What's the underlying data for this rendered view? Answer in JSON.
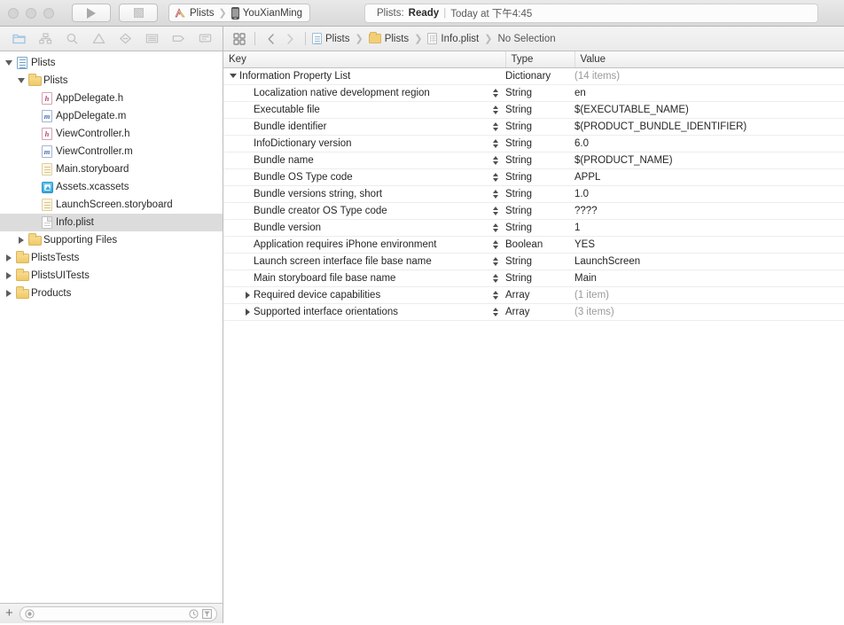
{
  "window": {
    "traffic_lights": [
      "close",
      "minimize",
      "zoom"
    ]
  },
  "toolbar": {
    "run_label": "Run",
    "stop_label": "Stop",
    "scheme": {
      "project": "Plists",
      "destination": "YouXianMing"
    }
  },
  "status": {
    "scheme": "Plists:",
    "state": "Ready",
    "divider": "|",
    "time": "Today at 下午4:45"
  },
  "navigator_tabs": [
    {
      "name": "project-navigator",
      "icon": "folder-icon"
    },
    {
      "name": "symbol-navigator",
      "icon": "hierarchy-icon"
    },
    {
      "name": "find-navigator",
      "icon": "search-icon"
    },
    {
      "name": "issue-navigator",
      "icon": "warning-triangle-icon"
    },
    {
      "name": "test-navigator",
      "icon": "breakpoint-diamond-icon"
    },
    {
      "name": "debug-navigator",
      "icon": "list-lines-icon"
    },
    {
      "name": "breakpoint-navigator",
      "icon": "tag-icon"
    },
    {
      "name": "report-navigator",
      "icon": "message-icon"
    }
  ],
  "jumpbar": {
    "back_label": "Back",
    "forward_label": "Forward",
    "related_label": "Related Items",
    "crumbs": [
      {
        "label": "Plists",
        "icon": "project-icon"
      },
      {
        "label": "Plists",
        "icon": "folder-icon"
      },
      {
        "label": "Info.plist",
        "icon": "plist-icon"
      },
      {
        "label": "No Selection",
        "icon": "none"
      }
    ]
  },
  "sidebar": {
    "items": [
      {
        "label": "Plists",
        "icon": "project-icon",
        "indent": 0,
        "twisty": "down",
        "selected": false
      },
      {
        "label": "Plists",
        "icon": "folder-icon",
        "indent": 1,
        "twisty": "down",
        "selected": false
      },
      {
        "label": "AppDelegate.h",
        "icon": "header-file-icon",
        "indent": 2,
        "twisty": "none",
        "selected": false
      },
      {
        "label": "AppDelegate.m",
        "icon": "source-file-icon",
        "indent": 2,
        "twisty": "none",
        "selected": false
      },
      {
        "label": "ViewController.h",
        "icon": "header-file-icon",
        "indent": 2,
        "twisty": "none",
        "selected": false
      },
      {
        "label": "ViewController.m",
        "icon": "source-file-icon",
        "indent": 2,
        "twisty": "none",
        "selected": false
      },
      {
        "label": "Main.storyboard",
        "icon": "storyboard-icon",
        "indent": 2,
        "twisty": "none",
        "selected": false
      },
      {
        "label": "Assets.xcassets",
        "icon": "asset-catalog-icon",
        "indent": 2,
        "twisty": "none",
        "selected": false
      },
      {
        "label": "LaunchScreen.storyboard",
        "icon": "storyboard-icon",
        "indent": 2,
        "twisty": "none",
        "selected": false
      },
      {
        "label": "Info.plist",
        "icon": "plist-icon",
        "indent": 2,
        "twisty": "none",
        "selected": true
      },
      {
        "label": "Supporting Files",
        "icon": "folder-icon",
        "indent": 1,
        "twisty": "right",
        "selected": false
      },
      {
        "label": "PlistsTests",
        "icon": "folder-icon",
        "indent": 0,
        "twisty": "right",
        "selected": false
      },
      {
        "label": "PlistsUITests",
        "icon": "folder-icon",
        "indent": 0,
        "twisty": "right",
        "selected": false
      },
      {
        "label": "Products",
        "icon": "folder-icon",
        "indent": 0,
        "twisty": "right",
        "selected": false
      }
    ],
    "footer": {
      "add_label": "+",
      "filter_placeholder": "",
      "recent_icon": "clock-icon",
      "filter_icon": "filter-icon"
    }
  },
  "table": {
    "columns": [
      "Key",
      "Type",
      "Value"
    ],
    "rows": [
      {
        "key": "Information Property List",
        "type": "Dictionary",
        "value": "(14 items)",
        "indent": 0,
        "twisty": "down",
        "stepper": false,
        "value_muted": true
      },
      {
        "key": "Localization native development region",
        "type": "String",
        "value": "en",
        "indent": 1,
        "twisty": "none",
        "stepper": true,
        "value_muted": false
      },
      {
        "key": "Executable file",
        "type": "String",
        "value": "$(EXECUTABLE_NAME)",
        "indent": 1,
        "twisty": "none",
        "stepper": true,
        "value_muted": false
      },
      {
        "key": "Bundle identifier",
        "type": "String",
        "value": "$(PRODUCT_BUNDLE_IDENTIFIER)",
        "indent": 1,
        "twisty": "none",
        "stepper": true,
        "value_muted": false
      },
      {
        "key": "InfoDictionary version",
        "type": "String",
        "value": "6.0",
        "indent": 1,
        "twisty": "none",
        "stepper": true,
        "value_muted": false
      },
      {
        "key": "Bundle name",
        "type": "String",
        "value": "$(PRODUCT_NAME)",
        "indent": 1,
        "twisty": "none",
        "stepper": true,
        "value_muted": false
      },
      {
        "key": "Bundle OS Type code",
        "type": "String",
        "value": "APPL",
        "indent": 1,
        "twisty": "none",
        "stepper": true,
        "value_muted": false
      },
      {
        "key": "Bundle versions string, short",
        "type": "String",
        "value": "1.0",
        "indent": 1,
        "twisty": "none",
        "stepper": true,
        "value_muted": false
      },
      {
        "key": "Bundle creator OS Type code",
        "type": "String",
        "value": "????",
        "indent": 1,
        "twisty": "none",
        "stepper": true,
        "value_muted": false
      },
      {
        "key": "Bundle version",
        "type": "String",
        "value": "1",
        "indent": 1,
        "twisty": "none",
        "stepper": true,
        "value_muted": false
      },
      {
        "key": "Application requires iPhone environment",
        "type": "Boolean",
        "value": "YES",
        "indent": 1,
        "twisty": "none",
        "stepper": true,
        "value_muted": false
      },
      {
        "key": "Launch screen interface file base name",
        "type": "String",
        "value": "LaunchScreen",
        "indent": 1,
        "twisty": "none",
        "stepper": true,
        "value_muted": false
      },
      {
        "key": "Main storyboard file base name",
        "type": "String",
        "value": "Main",
        "indent": 1,
        "twisty": "none",
        "stepper": true,
        "value_muted": false
      },
      {
        "key": "Required device capabilities",
        "type": "Array",
        "value": "(1 item)",
        "indent": 1,
        "twisty": "right",
        "stepper": true,
        "value_muted": true
      },
      {
        "key": "Supported interface orientations",
        "type": "Array",
        "value": "(3 items)",
        "indent": 1,
        "twisty": "right",
        "stepper": true,
        "value_muted": true
      }
    ]
  },
  "colors": {
    "selection": "#dcdcdc",
    "folder": "#f2cf76",
    "muted_text": "#9a9a9a",
    "chrome": "#e9e9e9"
  }
}
